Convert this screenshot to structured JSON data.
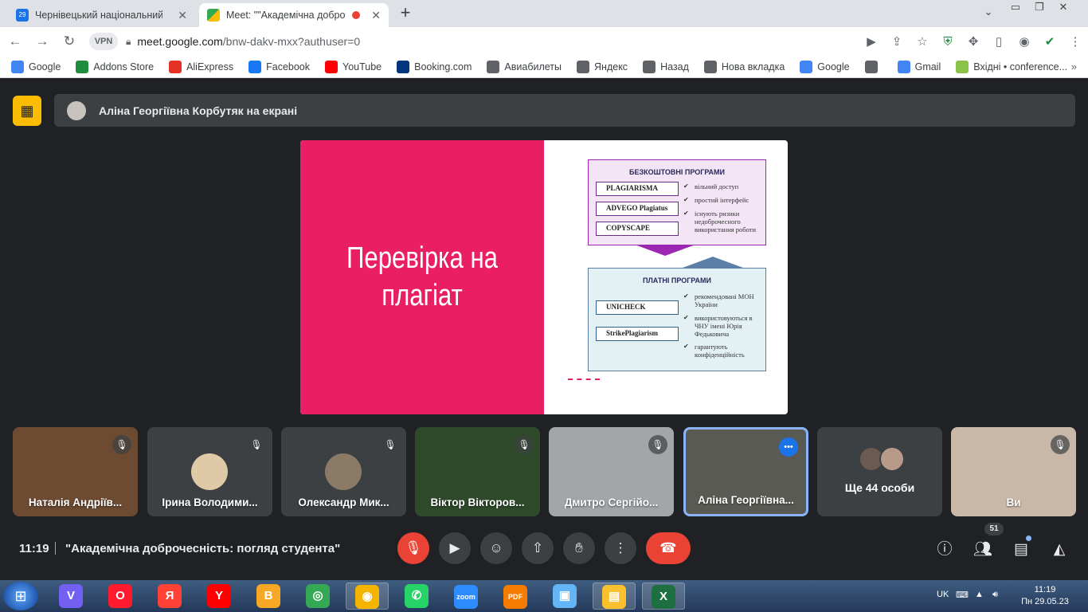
{
  "tabs": [
    {
      "title": "Чернівецький національний ун",
      "favicon": "calendar-icon",
      "favicon_color": "#1a73e8",
      "badge": "29"
    },
    {
      "title": "Meet: \"\"Академічна доброч",
      "favicon": "meet-icon",
      "favicon_color": "#34a853",
      "recording": true
    }
  ],
  "address": {
    "host": "meet.google.com",
    "path": "/bnw-dakv-mxx?authuser=0"
  },
  "vpn_label": "VPN",
  "bookmarks": [
    {
      "label": "Google",
      "icon": "google-icon",
      "color": "#4285f4"
    },
    {
      "label": "Addons Store",
      "icon": "addons-store-icon",
      "color": "#1e8e3e"
    },
    {
      "label": "AliExpress",
      "icon": "aliexpress-icon",
      "color": "#e43225"
    },
    {
      "label": "Facebook",
      "icon": "facebook-icon",
      "color": "#1877f2"
    },
    {
      "label": "YouTube",
      "icon": "youtube-icon",
      "color": "#ff0000"
    },
    {
      "label": "Booking.com",
      "icon": "booking-icon",
      "color": "#003580"
    },
    {
      "label": "Авиабилеты",
      "icon": "globe-icon",
      "color": "#5f6368"
    },
    {
      "label": "Яндекс",
      "icon": "globe-icon",
      "color": "#5f6368"
    },
    {
      "label": "Назад",
      "icon": "globe-icon",
      "color": "#5f6368"
    },
    {
      "label": "Нова вкладка",
      "icon": "folder-icon",
      "color": "#5f6368"
    },
    {
      "label": "Google",
      "icon": "google-icon",
      "color": "#4285f4"
    },
    {
      "label": "",
      "icon": "globe-icon",
      "color": "#5f6368"
    },
    {
      "label": "Gmail",
      "icon": "google-icon",
      "color": "#4285f4"
    },
    {
      "label": "Вхідні • conference...",
      "icon": "inbox-icon",
      "color": "#8bc34a"
    }
  ],
  "presenting": {
    "text": "Аліна Георгіївна Корбутяк на екрані"
  },
  "slide": {
    "title": "Перевірка на плагіат",
    "free": {
      "title": "БЕЗКОШТОВНІ ПРОГРАМИ",
      "programs": [
        "PLAGIARISMA",
        "ADVEGO Plagiatus",
        "COPYSCAPE"
      ],
      "features": [
        "вільний доступ",
        "простий інтерфейс",
        "існують ризики недоброчесного використання роботи"
      ]
    },
    "paid": {
      "title": "ПЛАТНІ ПРОГРАМИ",
      "programs": [
        "UNICHECK",
        "StrikePlagiarism"
      ],
      "features": [
        "рекомендовані МОН України",
        "використовуються в ЧНУ імені Юрія Федьковича",
        "гарантують конфіденційність"
      ]
    }
  },
  "participants": [
    {
      "name": "Наталія Андріїв...",
      "muted": true,
      "bg": "#6d4a32"
    },
    {
      "name": "Ірина Володими...",
      "muted": true,
      "bg": "#3c4043",
      "avatar": "#e0c9a6"
    },
    {
      "name": "Олександр Мик...",
      "muted": true,
      "bg": "#3c4043",
      "avatar": "#8a7a66"
    },
    {
      "name": "Віктор Вікторов...",
      "muted": true,
      "bg": "#2e4a2a"
    },
    {
      "name": "Дмитро Сергійо...",
      "muted": true,
      "bg": "#a3a6a8"
    },
    {
      "name": "Аліна Георгіївна...",
      "muted": false,
      "speaking": true,
      "bg": "#5a5a55"
    },
    {
      "name": "Ще 44 особи",
      "more": true,
      "bg": "#3c4043"
    },
    {
      "name": "Ви",
      "muted": true,
      "bg": "#c9b8a8"
    }
  ],
  "meeting": {
    "time": "11:19",
    "title": "\"Академічна доброчесність: погляд студента\"",
    "participant_count": "51"
  },
  "taskbar": {
    "apps": [
      {
        "name": "viber-icon",
        "label": "V",
        "color": "#7360f2"
      },
      {
        "name": "opera-icon",
        "label": "O",
        "color": "#ff1b2d"
      },
      {
        "name": "yandex-browser-icon",
        "label": "Я",
        "color": "#ff4136"
      },
      {
        "name": "yandex-icon",
        "label": "Y",
        "color": "#ff0000"
      },
      {
        "name": "bookmate-icon",
        "label": "B",
        "color": "#f9a825"
      },
      {
        "name": "chrome-icon",
        "label": "◎",
        "color": "#34a853"
      },
      {
        "name": "vpn-app-icon",
        "label": "◉",
        "color": "#f4b400"
      },
      {
        "name": "whatsapp-icon",
        "label": "✆",
        "color": "#25d366"
      },
      {
        "name": "zoom-icon",
        "label": "zoom",
        "color": "#2d8cff"
      },
      {
        "name": "pdf-icon",
        "label": "PDF",
        "color": "#f57c00"
      },
      {
        "name": "box-icon",
        "label": "▣",
        "color": "#64b5f6"
      },
      {
        "name": "explorer-icon",
        "label": "▤",
        "color": "#fbc02d"
      },
      {
        "name": "excel-icon",
        "label": "X",
        "color": "#1d6f42"
      }
    ],
    "lang": "UK",
    "time": "11:19",
    "date": "Пн 29.05.23"
  }
}
